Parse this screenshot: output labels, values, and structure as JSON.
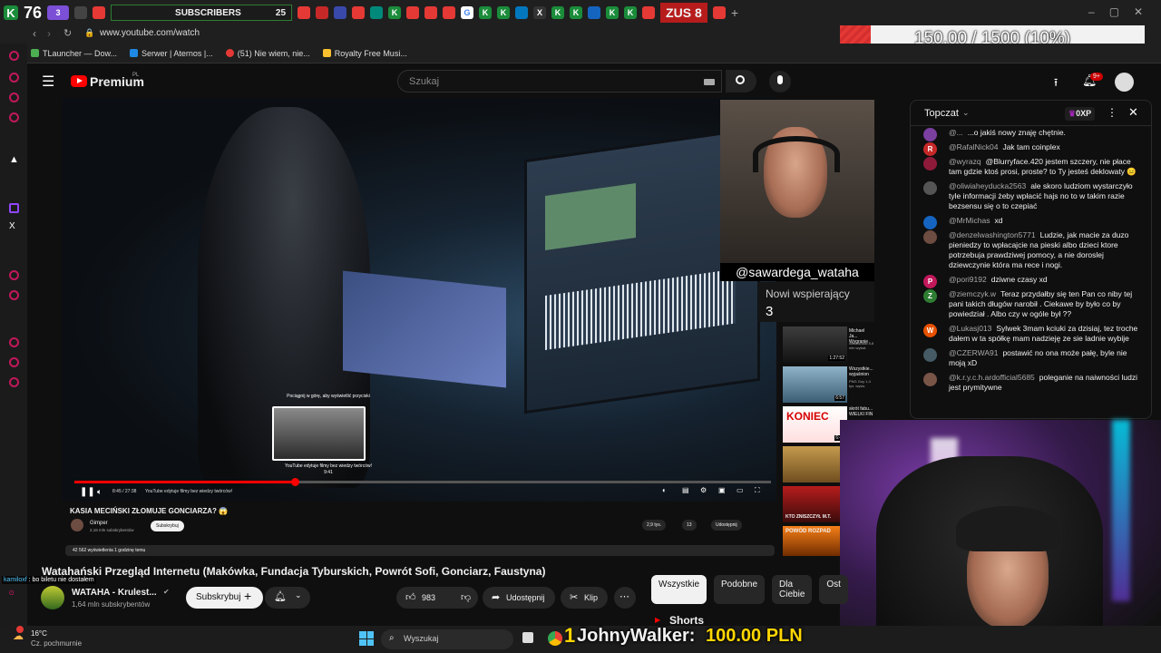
{
  "tabs": {
    "k_count": "76",
    "tab_badge": "3",
    "subscribers_label": "SUBSCRIBERS",
    "subscribers_count": "25",
    "zus": "ZUS",
    "zus_count": "8"
  },
  "goal": {
    "text": "150.00 / 1500 (10%)",
    "fraction": 0.1
  },
  "url": "www.youtube.com/watch",
  "bookmarks": [
    "TLauncher — Dow...",
    "Serwer | Aternos |...",
    "(51) Nie wiem, nie...",
    "Royalty Free Musi..."
  ],
  "yt": {
    "logo": "Premium",
    "logo_region": "PL",
    "search_placeholder": "Szukaj",
    "notif_badge": "9+"
  },
  "video": {
    "overlay_hint": "Pociągnij w górę, aby wyświetlić przyciski",
    "preview_title": "YouTube edytuje filmy bez wiedzy twórców!",
    "preview_time": "9:41",
    "time": "8:45 / 27:38",
    "chapter": "YouTube edytuje filmy bez wiedzy twórców!",
    "inner_title": "KASIA MECIŃSKI ZŁOMUJE GONCIARZA? 😱",
    "inner_channel": "Gimper",
    "inner_subs": "2,18 mln subskrybentów",
    "inner_sub_btn": "Subskrybuj",
    "inner_likes": "2,9 tys.",
    "inner_dislikes": "13",
    "inner_share": "Udostępnij",
    "inner_meta": "42 562 wyświetlenia  1 godzinę temu"
  },
  "streamer": {
    "handle": "@sawardega_wataha",
    "supporters_label": "Nowi wspierający",
    "supporters_count": "3"
  },
  "side_videos": [
    {
      "title": "Michael Ja... Wygranie",
      "meta": "ciekawostki 5,8 mln wyświ.",
      "time": "1:27:52"
    },
    {
      "title": "Wszystkie... wyjaśnion",
      "meta": "PNG Guy 1,4 tys. wyśw.",
      "time": "6:57"
    },
    {
      "title": "skrót fabu... WIELKI FIN",
      "meta": "",
      "time": "6:44"
    },
    {
      "title": "",
      "meta": "",
      "time": ""
    },
    {
      "title": "KTO ZNISZCZYŁ M.T.",
      "meta": "",
      "time": ""
    },
    {
      "title": "POWÓD ROZPAD",
      "meta": "",
      "time": ""
    }
  ],
  "chat": {
    "header": "Topczat",
    "xp": "0XP",
    "messages": [
      {
        "avatar": "",
        "color": "#7b3fa0",
        "user": "@...",
        "text": "...o jakiś nowy znaję chętnie."
      },
      {
        "avatar": "R",
        "color": "#c62828",
        "user": "@RafalNick04",
        "text": "Jak tam coinplex"
      },
      {
        "avatar": "",
        "color": "#8e1a3a",
        "user": "@wyrazq",
        "text": "@Blurryface.420 jestem szczery, nie płace tam gdzie ktoś prosi, proste? to Ty jesteś deklowaty 😑"
      },
      {
        "avatar": "",
        "color": "#555",
        "user": "@oliwiaheyducka2563",
        "text": "ale skoro ludziom wystarczyło tyle informacji żeby wpłacić hajs no to w takim razie bezsensu się o to czepiać"
      },
      {
        "avatar": "",
        "color": "#1565c0",
        "user": "@MrMichas",
        "text": "xd"
      },
      {
        "avatar": "",
        "color": "#6d4c41",
        "user": "@denzelwashington5771",
        "text": "Ludzie, jak macie za duzo pieniedzy to wpłacajcie na pieski albo dzieci ktore potrzebuja prawdziwej pomocy, a nie doroslej dziewczynie która ma rece i nogi."
      },
      {
        "avatar": "P",
        "color": "#c2185b",
        "user": "@pori9192",
        "text": "dziwne czasy xd"
      },
      {
        "avatar": "Z",
        "color": "#2e7d32",
        "user": "@ziemczyk.w",
        "text": "Teraz przydałby się ten Pan co niby tej pani takich długów narobił . Ciekawe by było co by powiedział . Albo czy w ogóle był ??"
      },
      {
        "avatar": "W",
        "color": "#e65100",
        "user": "@Lukasj013",
        "text": "Sylwek 3mam kciuki za dzisiaj, tez troche dałem w ta spółkę mam nadzieję ze sie ladnie wybije"
      },
      {
        "avatar": "",
        "color": "#455a64",
        "user": "@CZERWA91",
        "text": "postawić no ona może pałę, byle nie moją xD"
      },
      {
        "avatar": "",
        "color": "#795548",
        "user": "@k.r.y.c.h.ardofficial5685",
        "text": "poleganie na naiwności ludzi jest prymitywne"
      }
    ]
  },
  "main": {
    "title": "Watahański Przegląd Internetu (Makówka, Fundacja Tyburskich, Powrót Sofi, Gonciarz, Faustyna)",
    "channel": "WATAHA - Krulest...",
    "subs": "1,64 mln subskrybentów",
    "subscribe": "Subskrybuj",
    "likes": "983",
    "share": "Udostępnij",
    "clip": "Klip"
  },
  "filters": [
    "Wszystkie",
    "Podobne",
    "Dla Ciebie",
    "Ost"
  ],
  "shorts_label": "Shorts",
  "overlay_chat": {
    "user": "kamiloxf",
    "text": "bo biletu nie dostałem"
  },
  "taskbar": {
    "temp": "16°C",
    "weather": "Cz. pochmurnie",
    "search": "Wyszukaj",
    "donor": "JohnyWalker:",
    "amount": "100.00 PLN"
  }
}
